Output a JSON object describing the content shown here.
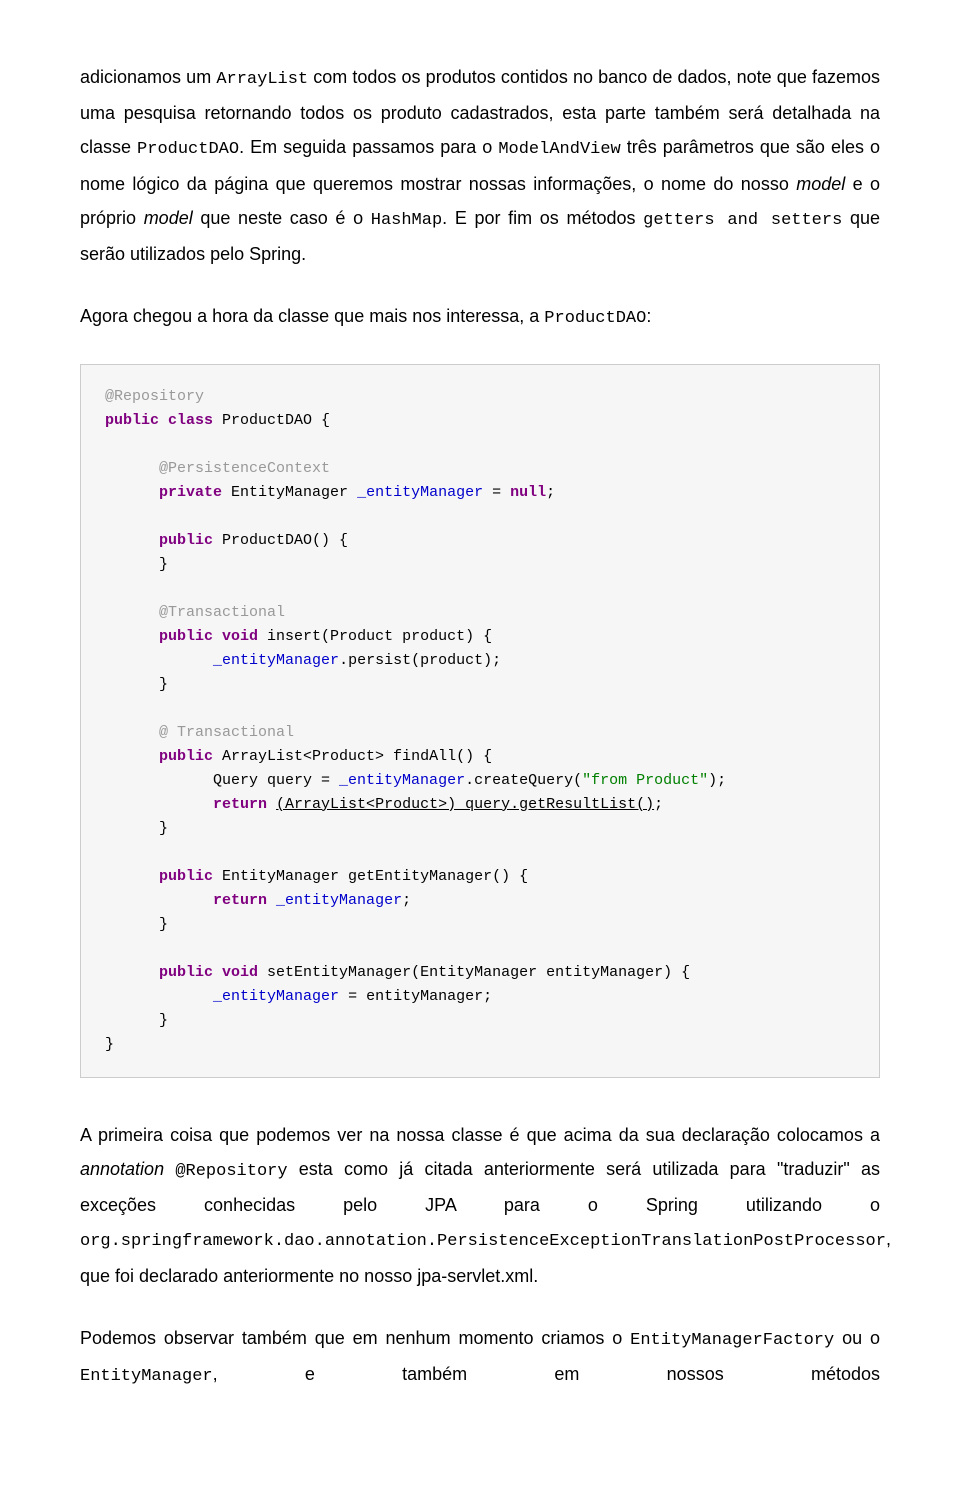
{
  "paragraphs": {
    "p1_pre": "adicionamos um ",
    "p1_code1": "ArrayList",
    "p1_mid1": " com todos os produtos contidos no banco de dados, note que fazemos uma pesquisa retornando todos os produto cadastrados, esta parte também será detalhada na classe ",
    "p1_code2": "ProductDAO",
    "p1_mid2": ". Em seguida passamos para o ",
    "p1_code3": "ModelAndView",
    "p1_mid3": " três parâmetros que são eles o nome lógico da página que queremos mostrar nossas informações, o nome do nosso ",
    "p1_italic1": "model",
    "p1_mid4": " e o próprio ",
    "p1_italic2": "model",
    "p1_mid5": " que neste caso é o ",
    "p1_code4": "HashMap",
    "p1_mid6": ". E por fim os métodos ",
    "p1_code5": "getters and setters",
    "p1_mid7": " que serão utilizados pelo Spring.",
    "p2_pre": "Agora chegou a hora da classe que mais nos interessa, a ",
    "p2_code1": "ProductDAO",
    "p2_post": ":",
    "p3_pre": "A primeira coisa que podemos ver na nossa classe é que acima da sua declaração colocamos a ",
    "p3_italic1": "annotation",
    "p3_space": " ",
    "p3_code1": "@Repository",
    "p3_mid1": " esta como já citada anteriormente será utilizada para \"traduzir\" as exceções conhecidas pelo JPA para o Spring utilizando o ",
    "p3_code2": "org.springframework.dao.annotation.PersistenceExceptionTranslationPostProcessor",
    "p3_mid2": ", que foi declarado anteriormente no nosso  jpa-servlet.xml.",
    "p4_pre": "Podemos observar também que em nenhum momento criamos o ",
    "p4_code1": "EntityManagerFactory",
    "p4_mid1": " ou o ",
    "p4_code2": "EntityManager",
    "p4_mid2": ", e também em nossos métodos"
  },
  "code": {
    "l1": "@Repository",
    "l2a": "public",
    "l2b": " class",
    "l2c": " ProductDAO {",
    "l3": "      @PersistenceContext",
    "l4a": "      private",
    "l4b": " EntityManager ",
    "l4c": "_entityManager",
    "l4d": " = ",
    "l4e": "null",
    "l4f": ";",
    "l5a": "      public",
    "l5b": " ProductDAO() {",
    "l6": "      }",
    "l7": "      @Transactional",
    "l8a": "      public",
    "l8b": " void",
    "l8c": " insert(Product product) {",
    "l9a": "            ",
    "l9b": "_entityManager",
    "l9c": ".persist(product);",
    "l10": "      }",
    "l11": "      @ Transactional",
    "l12a": "      public",
    "l12b": " ArrayList<Product> findAll() {",
    "l13a": "            Query query = ",
    "l13b": "_entityManager",
    "l13c": ".createQuery(",
    "l13d": "\"from Product\"",
    "l13e": ");",
    "l14a": "            return",
    "l14b": " ",
    "l14c": "(ArrayList<Product>) query.getResultList()",
    "l14d": ";",
    "l15": "      }",
    "l16a": "      public",
    "l16b": " EntityManager getEntityManager() {",
    "l17a": "            return",
    "l17b": " ",
    "l17c": "_entityManager",
    "l17d": ";",
    "l18": "      }",
    "l19a": "      public",
    "l19b": " void",
    "l19c": " setEntityManager(EntityManager entityManager) {",
    "l20a": "            ",
    "l20b": "_entityManager",
    "l20c": " = entityManager;",
    "l21": "      }",
    "l22": "}"
  }
}
